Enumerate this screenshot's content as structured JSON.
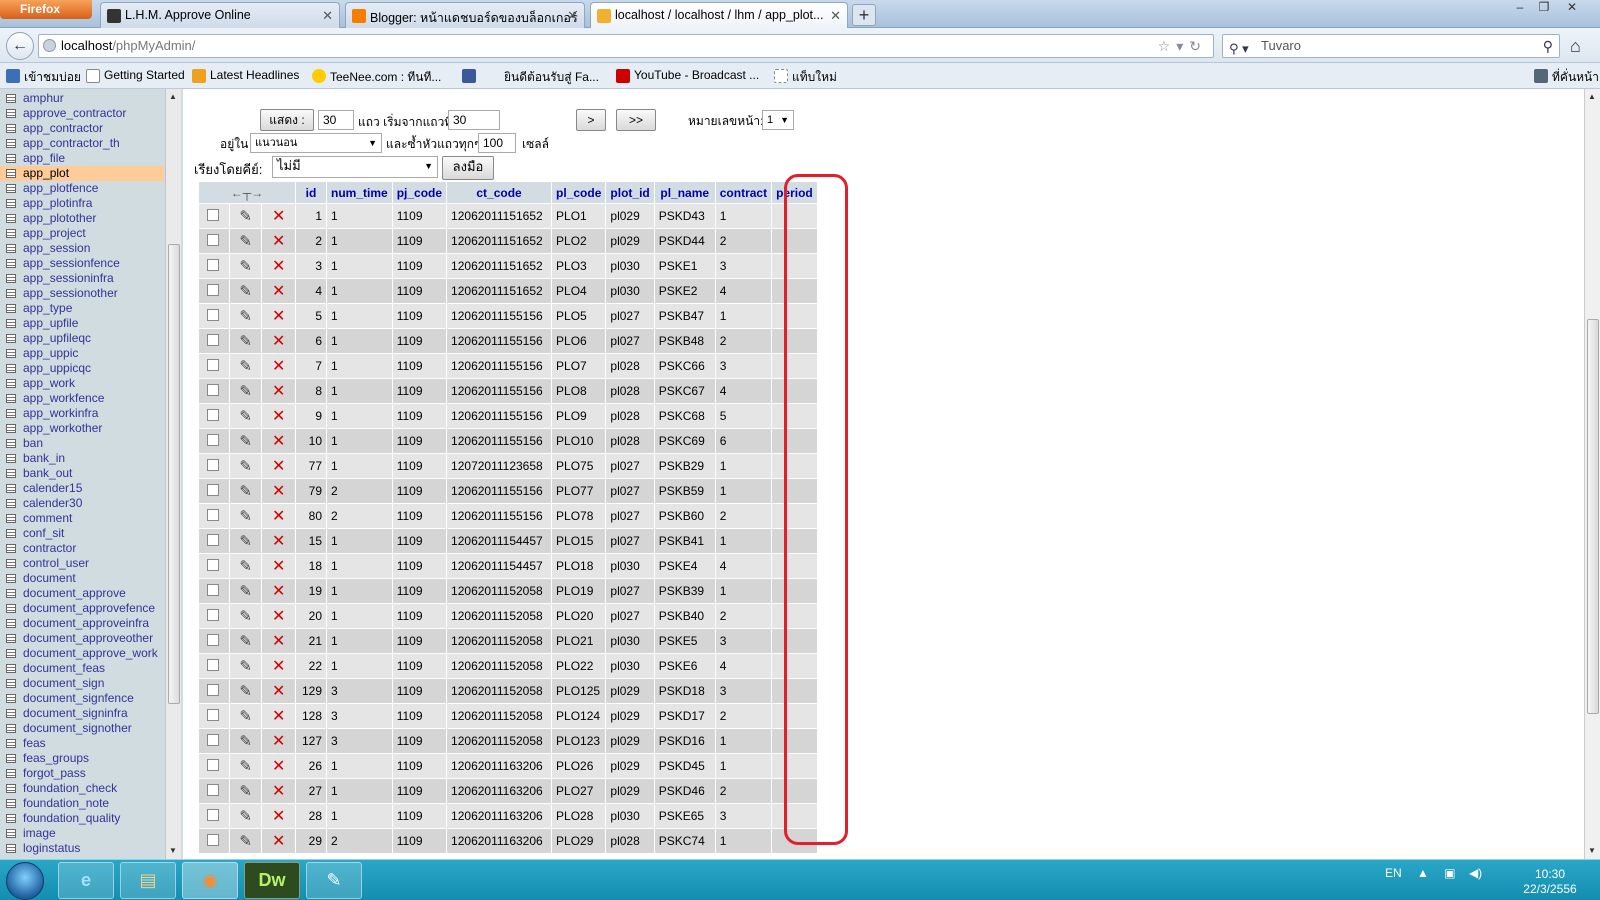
{
  "browser": {
    "menu_label": "Firefox",
    "tabs": [
      {
        "label": "L.H.M. Approve Online",
        "icon_color": "#333333"
      },
      {
        "label": "Blogger: หน้าแดชบอร์ดของบล็อกเกอร์",
        "icon_color": "#f57d00"
      },
      {
        "label": "localhost / localhost / lhm / app_plot...",
        "icon_color": "#f0b030"
      }
    ],
    "url_host": "localhost",
    "url_path": "/phpMyAdmin/",
    "search_placeholder": "Tuvaro",
    "bookmarks": [
      {
        "label": "เข้าชมบ่อย",
        "icon_color": "#3b6fb6"
      },
      {
        "label": "Getting Started",
        "icon_color": "#ffffff"
      },
      {
        "label": "Latest Headlines",
        "icon_color": "#f0a020"
      },
      {
        "label": "TeeNee.com : ทีนที...",
        "icon_color": "#ffcc00"
      },
      {
        "label": "",
        "icon_color": "#3b5998"
      },
      {
        "label": "ยินดีต้อนรับสู่ Fa...",
        "icon_color": "#e6edf5"
      },
      {
        "label": "YouTube - Broadcast ...",
        "icon_color": "#cc0000"
      },
      {
        "label": "แท็บใหม่",
        "icon_color": "#ffffff"
      },
      {
        "label": "ที่คั่นหน้า",
        "icon_color": "#556677"
      }
    ]
  },
  "sidebar": {
    "active": "app_plot",
    "tables": [
      "amphur",
      "approve_contractor",
      "app_contractor",
      "app_contractor_th",
      "app_file",
      "app_plot",
      "app_plotfence",
      "app_plotinfra",
      "app_plotother",
      "app_project",
      "app_session",
      "app_sessionfence",
      "app_sessioninfra",
      "app_sessionother",
      "app_type",
      "app_upfile",
      "app_upfileqc",
      "app_uppic",
      "app_uppicqc",
      "app_work",
      "app_workfence",
      "app_workinfra",
      "app_workother",
      "ban",
      "bank_in",
      "bank_out",
      "calender15",
      "calender30",
      "comment",
      "conf_sit",
      "contractor",
      "control_user",
      "document",
      "document_approve",
      "document_approvefence",
      "document_approveinfra",
      "document_approveother",
      "document_approve_work",
      "document_feas",
      "document_sign",
      "document_signfence",
      "document_signinfra",
      "document_signother",
      "feas",
      "feas_groups",
      "forgot_pass",
      "foundation_check",
      "foundation_note",
      "foundation_quality",
      "image",
      "loginstatus"
    ]
  },
  "controls": {
    "show_button": "แสดง :",
    "rows_value": "30",
    "start_label": "แถว เริ่มจากแถวที่",
    "start_value": "30",
    "next_button": ">",
    "last_button": ">>",
    "page_label": "หมายเลขหน้า:",
    "page_value": "1",
    "mode_label": "อยู่ใน",
    "mode_value": "แนวนอน",
    "repeat_label": "และซ้ำหัวแถวทุกๆ",
    "repeat_value": "100",
    "cells_label": "เซลล์",
    "sort_label": "เรียงโดยคีย์:",
    "sort_value": "ไม่มี",
    "go_button": "ลงมือ"
  },
  "grid": {
    "columns": [
      "id",
      "num_time",
      "pj_code",
      "ct_code",
      "pl_code",
      "plot_id",
      "pl_name",
      "contract",
      "period"
    ],
    "rows": [
      [
        "1",
        "1",
        "1109",
        "12062011151652",
        "PLO1",
        "pl029",
        "PSKD43",
        "1",
        ""
      ],
      [
        "2",
        "1",
        "1109",
        "12062011151652",
        "PLO2",
        "pl029",
        "PSKD44",
        "2",
        ""
      ],
      [
        "3",
        "1",
        "1109",
        "12062011151652",
        "PLO3",
        "pl030",
        "PSKE1",
        "3",
        ""
      ],
      [
        "4",
        "1",
        "1109",
        "12062011151652",
        "PLO4",
        "pl030",
        "PSKE2",
        "4",
        ""
      ],
      [
        "5",
        "1",
        "1109",
        "12062011155156",
        "PLO5",
        "pl027",
        "PSKB47",
        "1",
        ""
      ],
      [
        "6",
        "1",
        "1109",
        "12062011155156",
        "PLO6",
        "pl027",
        "PSKB48",
        "2",
        ""
      ],
      [
        "7",
        "1",
        "1109",
        "12062011155156",
        "PLO7",
        "pl028",
        "PSKC66",
        "3",
        ""
      ],
      [
        "8",
        "1",
        "1109",
        "12062011155156",
        "PLO8",
        "pl028",
        "PSKC67",
        "4",
        ""
      ],
      [
        "9",
        "1",
        "1109",
        "12062011155156",
        "PLO9",
        "pl028",
        "PSKC68",
        "5",
        ""
      ],
      [
        "10",
        "1",
        "1109",
        "12062011155156",
        "PLO10",
        "pl028",
        "PSKC69",
        "6",
        ""
      ],
      [
        "77",
        "1",
        "1109",
        "12072011123658",
        "PLO75",
        "pl027",
        "PSKB29",
        "1",
        ""
      ],
      [
        "79",
        "2",
        "1109",
        "12062011155156",
        "PLO77",
        "pl027",
        "PSKB59",
        "1",
        ""
      ],
      [
        "80",
        "2",
        "1109",
        "12062011155156",
        "PLO78",
        "pl027",
        "PSKB60",
        "2",
        ""
      ],
      [
        "15",
        "1",
        "1109",
        "12062011154457",
        "PLO15",
        "pl027",
        "PSKB41",
        "1",
        ""
      ],
      [
        "18",
        "1",
        "1109",
        "12062011154457",
        "PLO18",
        "pl030",
        "PSKE4",
        "4",
        ""
      ],
      [
        "19",
        "1",
        "1109",
        "12062011152058",
        "PLO19",
        "pl027",
        "PSKB39",
        "1",
        ""
      ],
      [
        "20",
        "1",
        "1109",
        "12062011152058",
        "PLO20",
        "pl027",
        "PSKB40",
        "2",
        ""
      ],
      [
        "21",
        "1",
        "1109",
        "12062011152058",
        "PLO21",
        "pl030",
        "PSKE5",
        "3",
        ""
      ],
      [
        "22",
        "1",
        "1109",
        "12062011152058",
        "PLO22",
        "pl030",
        "PSKE6",
        "4",
        ""
      ],
      [
        "129",
        "3",
        "1109",
        "12062011152058",
        "PLO125",
        "pl029",
        "PSKD18",
        "3",
        ""
      ],
      [
        "128",
        "3",
        "1109",
        "12062011152058",
        "PLO124",
        "pl029",
        "PSKD17",
        "2",
        ""
      ],
      [
        "127",
        "3",
        "1109",
        "12062011152058",
        "PLO123",
        "pl029",
        "PSKD16",
        "1",
        ""
      ],
      [
        "26",
        "1",
        "1109",
        "12062011163206",
        "PLO26",
        "pl029",
        "PSKD45",
        "1",
        ""
      ],
      [
        "27",
        "1",
        "1109",
        "12062011163206",
        "PLO27",
        "pl029",
        "PSKD46",
        "2",
        ""
      ],
      [
        "28",
        "1",
        "1109",
        "12062011163206",
        "PLO28",
        "pl030",
        "PSKE65",
        "3",
        ""
      ],
      [
        "29",
        "2",
        "1109",
        "12062011163206",
        "PLO29",
        "pl028",
        "PSKC74",
        "1",
        ""
      ]
    ]
  },
  "taskbar": {
    "apps": [
      "e",
      "▤",
      "◉",
      "Dw",
      "✎"
    ],
    "lang": "EN",
    "time": "10:30",
    "date": "22/3/2556"
  },
  "colors": {
    "highlight": "#e0202a",
    "active_table": "#ffcc99",
    "header_text": "#0000aa"
  }
}
